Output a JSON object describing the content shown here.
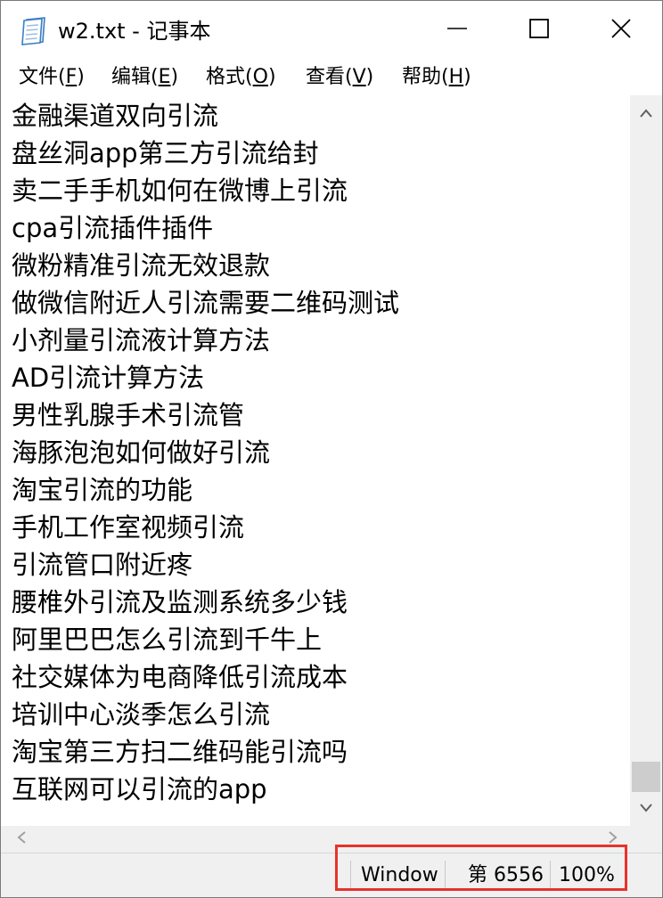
{
  "window": {
    "title": "w2.txt - 记事本"
  },
  "menu": {
    "items": [
      {
        "label": "文件",
        "key": "F"
      },
      {
        "label": "编辑",
        "key": "E"
      },
      {
        "label": "格式",
        "key": "O"
      },
      {
        "label": "查看",
        "key": "V"
      },
      {
        "label": "帮助",
        "key": "H"
      }
    ]
  },
  "editor": {
    "lines": [
      "金融渠道双向引流",
      "盘丝洞app第三方引流给封",
      "卖二手手机如何在微博上引流",
      "cpa引流插件插件",
      "微粉精准引流无效退款",
      "做微信附近人引流需要二维码测试",
      "小剂量引流液计算方法",
      "AD引流计算方法",
      "男性乳腺手术引流管",
      "海豚泡泡如何做好引流",
      "淘宝引流的功能",
      "手机工作室视频引流",
      "引流管口附近疼",
      "腰椎外引流及监测系统多少钱",
      "阿里巴巴怎么引流到千牛上",
      "社交媒体为电商降低引流成本",
      "培训中心淡季怎么引流",
      "淘宝第三方扫二维码能引流吗",
      "互联网可以引流的app"
    ]
  },
  "statusbar": {
    "line_ending": "Window",
    "position": "第 6556",
    "zoom": "100%"
  },
  "colors": {
    "highlight_border": "#e8322a",
    "chrome": "#f0f0f0"
  },
  "icons": {
    "app": "notepad-icon",
    "minimize": "minimize-icon",
    "maximize": "maximize-icon",
    "close": "close-icon"
  }
}
